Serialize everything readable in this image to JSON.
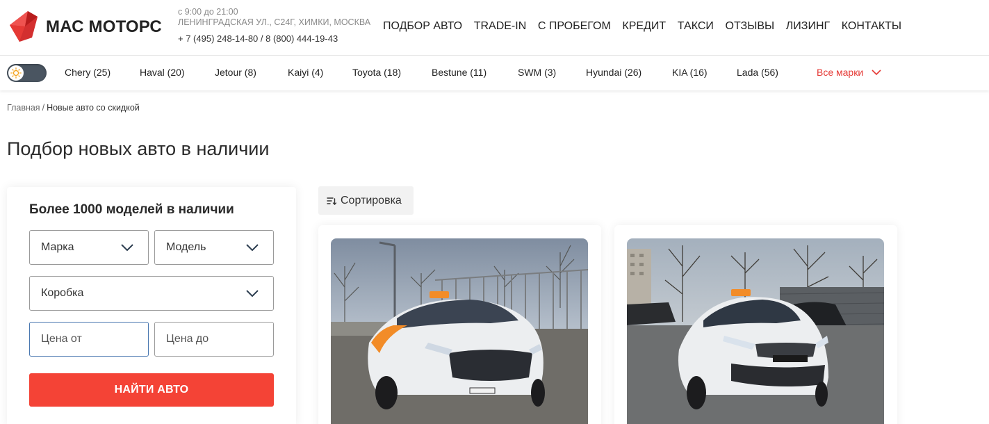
{
  "header": {
    "logo_text": "МАС МОТОРС",
    "hours": "с 9:00 до 21:00",
    "address": "ЛЕНИНГРАДСКАЯ УЛ., С24Г, ХИМКИ, МОСКВА",
    "phones": "+ 7 (495) 248-14-80 / 8 (800) 444-19-43",
    "nav": [
      "ПОДБОР АВТО",
      "TRADE-IN",
      "С ПРОБЕГОМ",
      "КРЕДИТ",
      "ТАКСИ",
      "ОТЗЫВЫ",
      "ЛИЗИНГ",
      "КОНТАКТЫ"
    ],
    "brand_color": "#e53935"
  },
  "brands": {
    "items": [
      "Chery (25)",
      "Haval (20)",
      "Jetour (8)",
      "Kaiyi (4)",
      "Toyota (18)",
      "Bestune (11)",
      "SWM (3)",
      "Hyundai (26)",
      "KIA (16)",
      "Lada (56)"
    ],
    "all_label": "Все марки",
    "theme_toggle_icon": "sun-icon"
  },
  "breadcrumb": {
    "home": "Главная",
    "separator": "/",
    "current": "Новые авто со скидкой"
  },
  "page": {
    "title": "Подбор новых авто в наличии"
  },
  "filter": {
    "title": "Более 1000 моделей в наличии",
    "make_label": "Марка",
    "model_label": "Модель",
    "gearbox_label": "Коробка",
    "price_from_placeholder": "Цена от",
    "price_to_placeholder": "Цена до",
    "submit_label": "НАЙТИ АВТО",
    "button_color": "#f44336"
  },
  "sort": {
    "label": "Сортировка",
    "icon": "sort-icon"
  }
}
